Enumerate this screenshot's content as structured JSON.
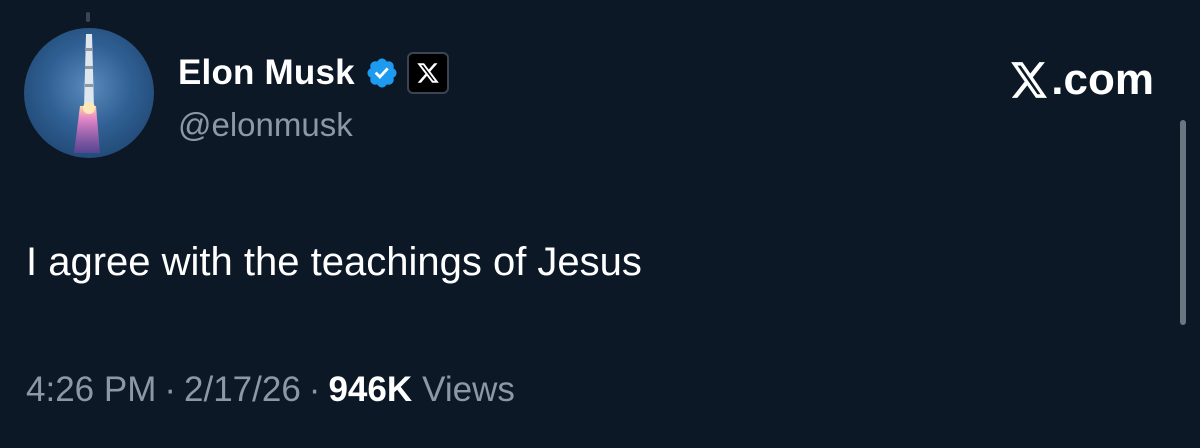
{
  "user": {
    "display_name": "Elon Musk",
    "handle": "@elonmusk",
    "verified": true,
    "affiliation_badge": "x-logo-icon",
    "avatar": "rocket-launch-avatar"
  },
  "site": {
    "label": ".com"
  },
  "tweet": {
    "text": "I agree with the teachings of Jesus",
    "time": "4:26 PM",
    "date": "2/17/26",
    "separator": "·",
    "views_count": "946K",
    "views_label": "Views"
  },
  "colors": {
    "background": "#0c1825",
    "primary_text": "#ffffff",
    "secondary_text": "#8b98a5",
    "verified_badge": "#1d9bf0"
  }
}
